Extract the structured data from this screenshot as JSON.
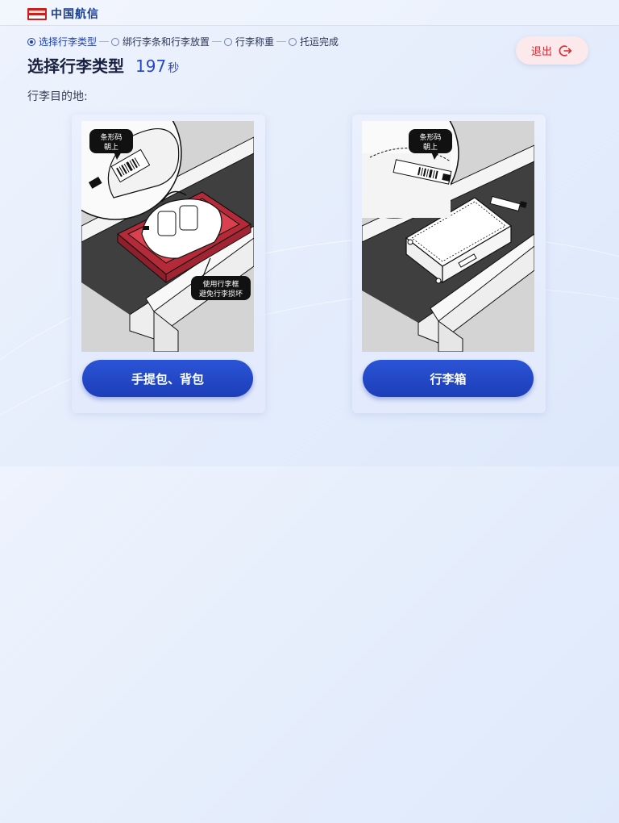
{
  "brand": {
    "name": "中国航信"
  },
  "steps": [
    {
      "label": "选择行李类型",
      "active": true
    },
    {
      "label": "绑行李条和行李放置",
      "active": false
    },
    {
      "label": "行李称重",
      "active": false
    },
    {
      "label": "托运完成",
      "active": false
    }
  ],
  "page": {
    "title": "选择行李类型",
    "countdown": "197",
    "countdown_unit": "秒"
  },
  "exit": {
    "label": "退出",
    "icon": "logout-icon"
  },
  "destination": {
    "label": "行李目的地:"
  },
  "options": [
    {
      "button_label": "手提包、背包",
      "tip_barcode": [
        "条形码",
        "朝上"
      ],
      "tip_frame": [
        "使用行李框",
        "避免行李损坏"
      ]
    },
    {
      "button_label": "行李箱",
      "tip_barcode": [
        "条形码",
        "朝上"
      ]
    }
  ],
  "colors": {
    "primary": "#1d3eb8",
    "accent": "#2448c8",
    "exit": "#d9282f",
    "tray": "#c32d3b"
  }
}
